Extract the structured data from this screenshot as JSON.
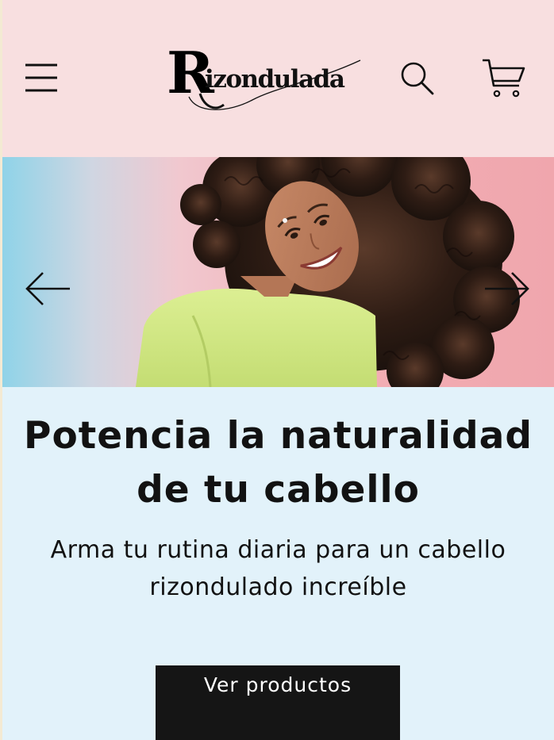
{
  "header": {
    "menu_icon": "hamburger-menu-icon",
    "logo_text": "Rizondulada",
    "logo_initial": "R",
    "logo_rest": "izondulada",
    "search_icon": "search-icon",
    "cart_icon": "shopping-cart-icon",
    "background": "#f8dfe0"
  },
  "hero": {
    "image_alt": "Mujer sonriente con cabello rizado y suéter verde lima",
    "prev_icon": "arrow-left-icon",
    "next_icon": "arrow-right-icon"
  },
  "main": {
    "headline": "Potencia la naturalidad de tu cabello",
    "subheadline": "Arma tu rutina diaria para un cabello rizondulado increíble",
    "cta_label": "Ver productos",
    "background": "#e2f2fa",
    "cta_background": "#151515"
  }
}
